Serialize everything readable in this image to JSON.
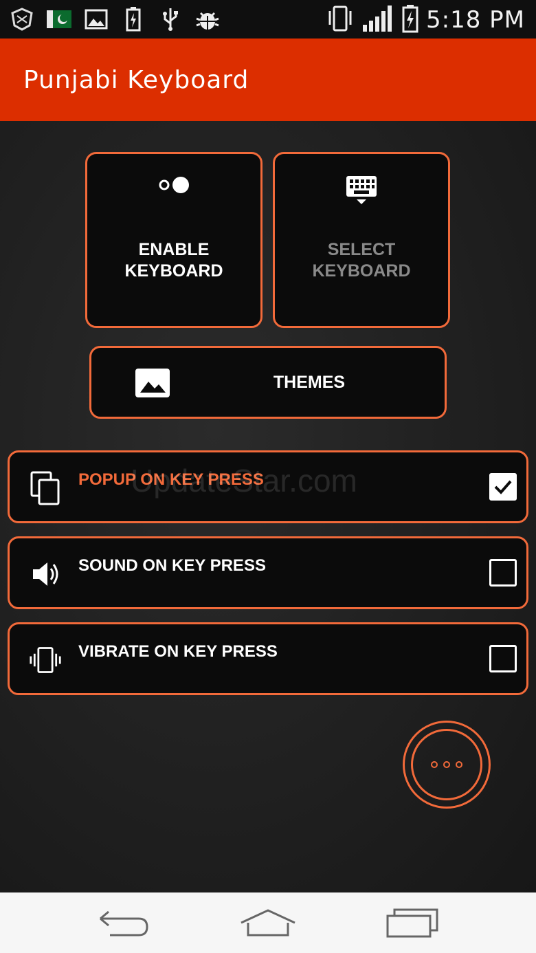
{
  "status_bar": {
    "time": "5:18 PM",
    "left_icons": [
      "shield-icon",
      "pakistan-flag-icon",
      "image-icon",
      "battery-charging-icon",
      "usb-icon",
      "android-debug-icon"
    ],
    "right_icons": [
      "vibrate-icon",
      "signal-icon",
      "battery-icon"
    ]
  },
  "app_bar": {
    "title": "Punjabi Keyboard",
    "color": "#dc2e00"
  },
  "tiles": {
    "enable": {
      "label": "ENABLE KEYBOARD",
      "icon": "toggle-icon"
    },
    "select": {
      "label": "SELECT KEYBOARD",
      "icon": "keyboard-icon"
    }
  },
  "themes": {
    "label": "THEMES",
    "icon": "image-icon"
  },
  "options": [
    {
      "label": "POPUP ON KEY PRESS",
      "icon": "copy-icon",
      "checked": true
    },
    {
      "label": "SOUND ON KEY PRESS",
      "icon": "speaker-icon",
      "checked": false
    },
    {
      "label": "VIBRATE ON KEY PRESS",
      "icon": "vibrate-icon",
      "checked": false
    }
  ],
  "watermark": "UpdateStar.com",
  "fab": {
    "icon": "more-dots-icon"
  },
  "nav_bar": {
    "icons": [
      "back-icon",
      "home-icon",
      "recents-icon"
    ]
  },
  "colors": {
    "accent": "#f26a3a",
    "tile_bg": "#0b0b0b"
  }
}
